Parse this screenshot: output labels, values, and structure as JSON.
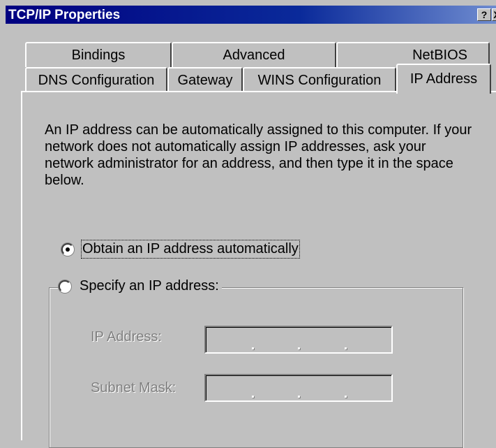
{
  "window": {
    "title": "TCP/IP Properties",
    "help_button": "?",
    "close_button": "X"
  },
  "tabs_row1": [
    "Bindings",
    "Advanced",
    "NetBIOS"
  ],
  "tabs_row2": [
    "DNS Configuration",
    "Gateway",
    "WINS Configuration",
    "IP Address"
  ],
  "active_tab": "IP Address",
  "description": "An IP address can be automatically assigned to this computer. If your network does not automatically assign IP addresses, ask your network administrator for an address, and then type it in the space below.",
  "options": {
    "obtain_automatically": {
      "label": "Obtain an IP address automatically",
      "selected": true
    },
    "specify": {
      "label": "Specify an IP address:",
      "selected": false
    }
  },
  "fields": {
    "ip_address": {
      "label": "IP Address:",
      "value": "",
      "enabled": false
    },
    "subnet_mask": {
      "label": "Subnet Mask:",
      "value": "",
      "enabled": false
    }
  },
  "colors": {
    "title_bar": "#000080",
    "face": "#c0c0c0"
  }
}
